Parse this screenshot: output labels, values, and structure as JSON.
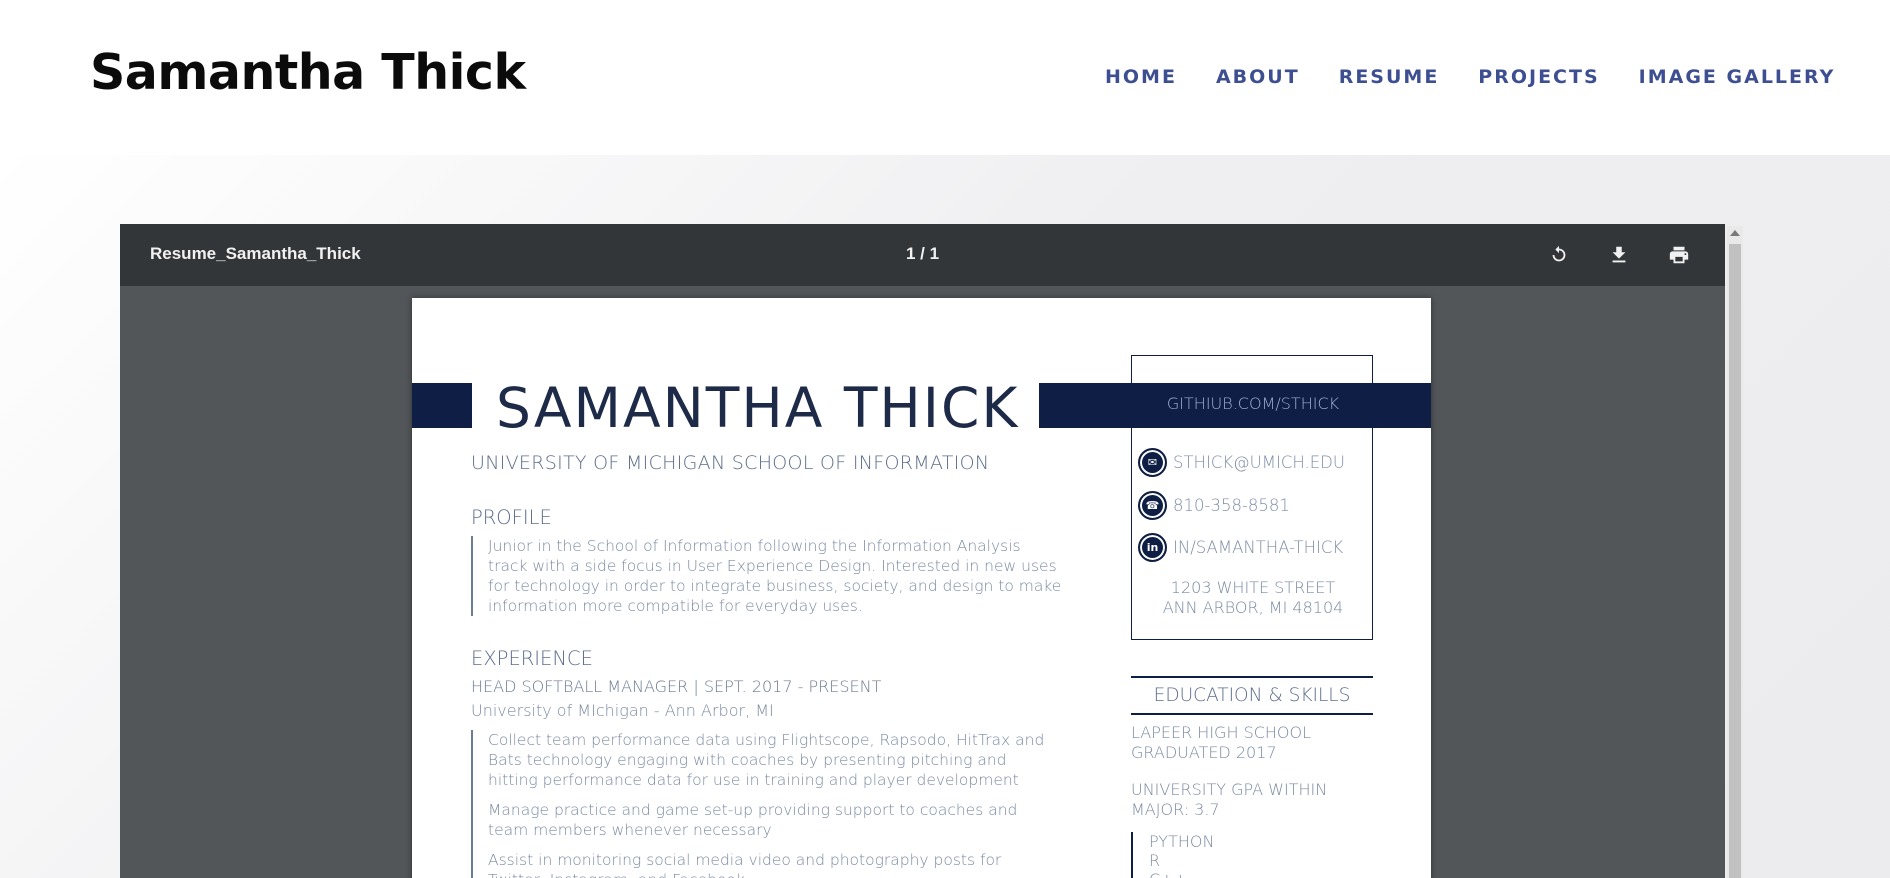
{
  "site": {
    "title": "Samantha Thick",
    "nav": [
      "HOME",
      "ABOUT",
      "RESUME",
      "PROJECTS",
      "IMAGE GALLERY"
    ]
  },
  "viewer": {
    "document_name": "Resume_Samantha_Thick",
    "page_indicator": "1 / 1",
    "tools": [
      "rotate-icon",
      "download-icon",
      "print-icon"
    ]
  },
  "resume": {
    "name": "SAMANTHA THICK",
    "school": "UNIVERSITY OF MICHIGAN SCHOOL OF INFORMATION",
    "contact": {
      "github": "GITHIUB.COM/STHICK",
      "email": "STHICK@UMICH.EDU",
      "phone": "810-358-8581",
      "linkedin": "IN/SAMANTHA-THICK",
      "address_line1": "1203 WHITE STREET",
      "address_line2": "ANN ARBOR, MI 48104"
    },
    "profile": {
      "heading": "PROFILE",
      "lines": [
        "Junior in the School of Information following the Information Analysis",
        "track with a side focus in User Experience Design.  Interested in new uses",
        "for technology in order to integrate business, society, and design to make",
        "information more compatible for everyday uses."
      ]
    },
    "experience": {
      "heading": "EXPERIENCE",
      "job_title": "HEAD SOFTBALL MANAGER  |  SEPT. 2017 - PRESENT",
      "job_org": "University of MIchigan - Ann Arbor, MI",
      "bullets": [
        [
          "Collect team performance data using Flightscope, Rapsodo, HitTrax and",
          "Bats technology engaging with coaches by presenting pitching and",
          "hitting performance data for use in training and player development"
        ],
        [
          "Manage practice and game set-up providing support to coaches and",
          "team members whenever necessary"
        ],
        [
          "Assist in monitoring social media video and photography posts for",
          "Twitter, Instagram, and Facebook"
        ]
      ]
    },
    "education": {
      "heading": "EDUCATION & SKILLS",
      "hs_line1": "LAPEER HIGH SCHOOL",
      "hs_line2": "GRADUATED 2017",
      "gpa_line1": "UNIVERSITY GPA WITHIN",
      "gpa_line2": "MAJOR: 3.7",
      "skills": [
        "PYTHON",
        "R",
        "C++"
      ]
    }
  },
  "colors": {
    "nav": "#3e4f91",
    "toolbar": "#323639",
    "viewer_bg": "#525659",
    "resume_navy": "#0e1e44"
  }
}
